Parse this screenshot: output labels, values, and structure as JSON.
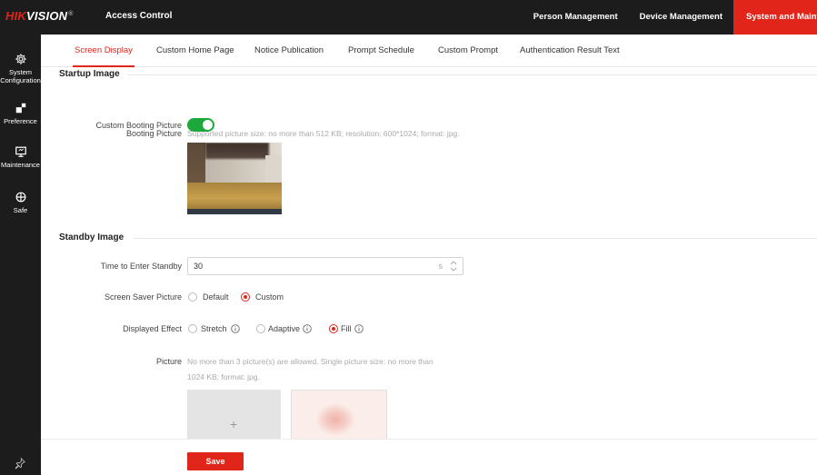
{
  "header": {
    "logo_red": "HIK",
    "logo_white": "VISION",
    "logo_mark": "®",
    "app_title": "Access Control",
    "nav": [
      "Person Management",
      "Device Management",
      "System and Mainten"
    ]
  },
  "sidebar": {
    "items": [
      {
        "label_1": "System",
        "label_2": "Configuration",
        "icon": "gear-icon"
      },
      {
        "label_1": "Preference",
        "label_2": "",
        "icon": "preference-icon"
      },
      {
        "label_1": "Maintenance",
        "label_2": "",
        "icon": "monitor-icon"
      },
      {
        "label_1": "Safe",
        "label_2": "",
        "icon": "shield-icon"
      }
    ],
    "pin_icon": "pin-icon"
  },
  "tabs": [
    "Screen Display",
    "Custom Home Page",
    "Notice Publication",
    "Prompt Schedule",
    "Custom Prompt",
    "Authentication Result Text"
  ],
  "startup": {
    "title": "Startup Image",
    "custom_booting_label": "Custom Booting Picture",
    "custom_booting_enabled": true,
    "booting_picture_label": "Booting Picture",
    "booting_picture_hint": "Supported picture size: no more than 512 KB; resolution: 600*1024; format: jpg."
  },
  "standby": {
    "title": "Standby Image",
    "time_label": "Time to Enter Standby",
    "time_value": "30",
    "time_unit": "s",
    "saver_label": "Screen Saver Picture",
    "saver_options": [
      "Default",
      "Custom"
    ],
    "saver_selected": "Custom",
    "effect_label": "Displayed Effect",
    "effect_options": [
      "Stretch",
      "Adaptive",
      "Fill"
    ],
    "effect_selected": "Fill",
    "picture_label": "Picture",
    "picture_hint_1": "No more than 3 picture(s) are allowed. Single picture size: no more than",
    "picture_hint_2": "1024 KB; format: jpg.",
    "add_symbol": "+"
  },
  "footer": {
    "save_label": "Save"
  },
  "colors": {
    "accent": "#e1251b",
    "toggle_on": "#1ea83c",
    "chrome": "#1c1c1c"
  }
}
